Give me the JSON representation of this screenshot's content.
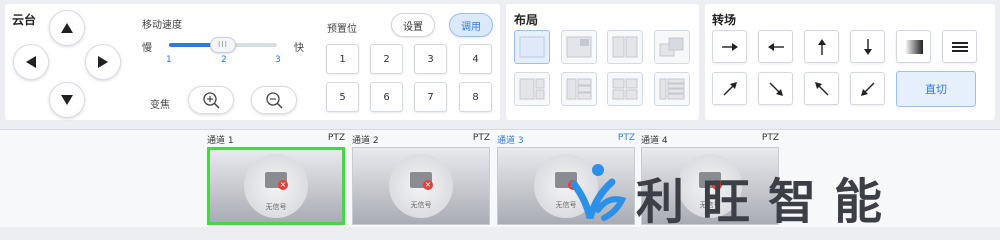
{
  "ptz": {
    "title": "云台",
    "speed_label": "移动速度",
    "slow": "慢",
    "fast": "快",
    "ticks": [
      "1",
      "2",
      "3"
    ],
    "speed_value": 2,
    "speed_fraction": 0.5,
    "thumb_glyph": "III",
    "zoom_label": "变焦",
    "preset_label": "预置位",
    "set_button": "设置",
    "call_button": "调用",
    "presets": [
      "1",
      "2",
      "3",
      "4",
      "5",
      "6",
      "7",
      "8"
    ]
  },
  "layout": {
    "title": "布局"
  },
  "transition": {
    "title": "转场",
    "cut_button": "直切",
    "icons": [
      "arrow-right-icon",
      "arrow-left-icon",
      "arrow-up-icon",
      "arrow-down-icon",
      "fade-icon",
      "menu-lines-icon",
      "arrow-up-right-icon",
      "arrow-down-right-icon",
      "arrow-up-left-icon",
      "arrow-down-left-icon"
    ]
  },
  "channels": [
    {
      "label": "通道 1",
      "tag": "PTZ",
      "no_signal": "无信号",
      "selected": true,
      "active": false
    },
    {
      "label": "通道 2",
      "tag": "PTZ",
      "no_signal": "无信号",
      "selected": false,
      "active": false
    },
    {
      "label": "通道 3",
      "tag": "PTZ",
      "no_signal": "无信号",
      "selected": false,
      "active": true
    },
    {
      "label": "通道 4",
      "tag": "PTZ",
      "no_signal": "无信号",
      "selected": false,
      "active": false
    }
  ],
  "watermark": {
    "text": "利旺智能"
  },
  "colors": {
    "accent": "#2c7be5",
    "selected_border": "#45d845"
  }
}
